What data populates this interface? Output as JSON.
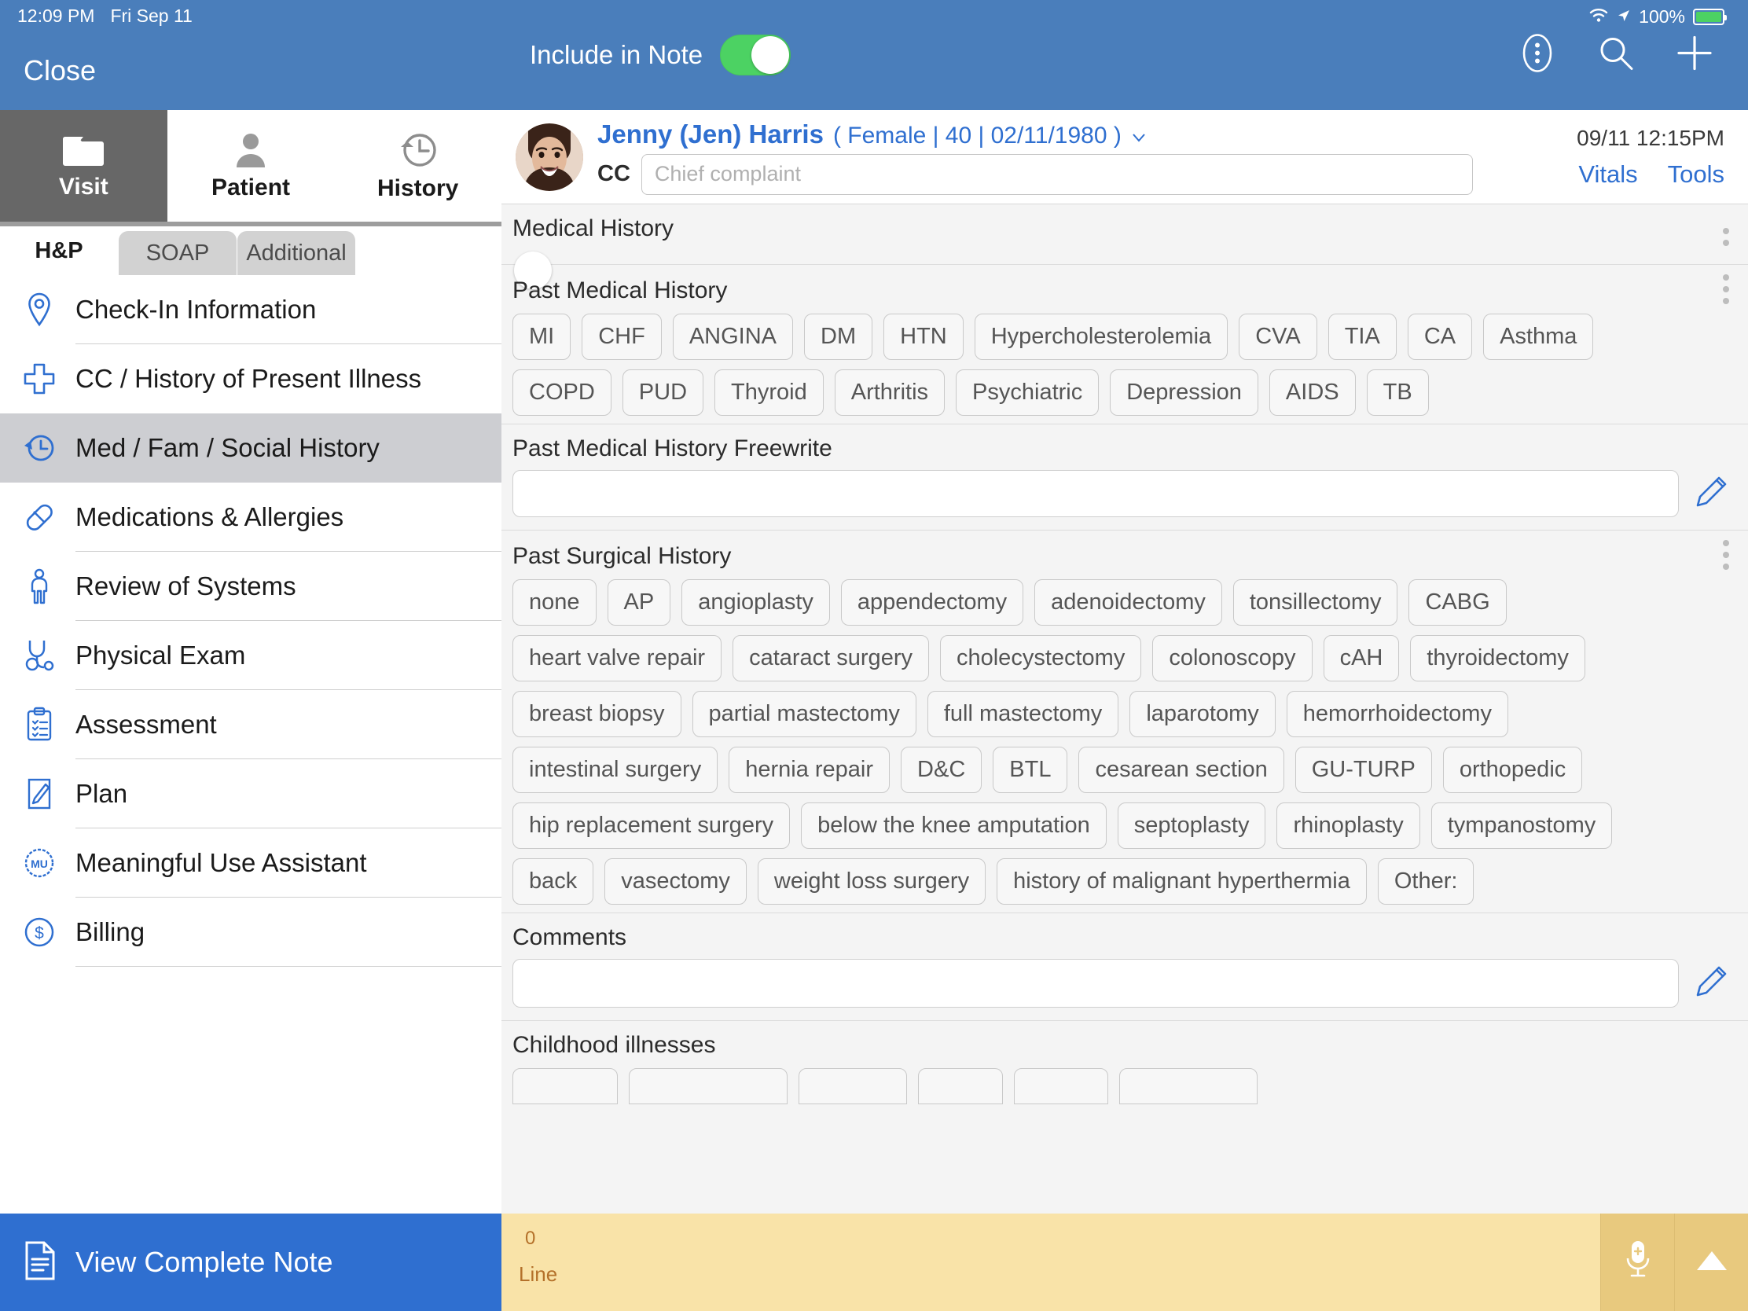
{
  "status_bar": {
    "time": "12:09 PM",
    "date": "Fri Sep 11",
    "battery_percent": "100%"
  },
  "left_panel": {
    "close_label": "Close",
    "mode_tabs": [
      {
        "label": "Visit",
        "icon": "folder-icon",
        "active": true
      },
      {
        "label": "Patient",
        "icon": "person-icon",
        "active": false
      },
      {
        "label": "History",
        "icon": "clock-history-icon",
        "active": false
      }
    ],
    "hp_tabs": [
      {
        "label": "H&P",
        "active": true
      },
      {
        "label": "SOAP",
        "active": false
      },
      {
        "label": "Additional",
        "active": false
      }
    ],
    "nav_items": [
      {
        "label": "Check-In Information",
        "icon": "map-pin-icon",
        "active": false
      },
      {
        "label": "CC / History of Present Illness",
        "icon": "plus-cross-icon",
        "active": false
      },
      {
        "label": "Med / Fam / Social History",
        "icon": "clock-history-icon",
        "active": true
      },
      {
        "label": "Medications & Allergies",
        "icon": "pill-icon",
        "active": false
      },
      {
        "label": "Review of Systems",
        "icon": "body-icon",
        "active": false
      },
      {
        "label": "Physical Exam",
        "icon": "stethoscope-icon",
        "active": false
      },
      {
        "label": "Assessment",
        "icon": "clipboard-checklist-icon",
        "active": false
      },
      {
        "label": "Plan",
        "icon": "pen-document-icon",
        "active": false
      },
      {
        "label": "Meaningful Use Assistant",
        "icon": "mu-badge-icon",
        "active": false
      },
      {
        "label": "Billing",
        "icon": "dollar-circle-icon",
        "active": false
      }
    ],
    "view_complete_note": "View Complete Note"
  },
  "top_bar": {
    "include_in_note_label": "Include in Note",
    "include_in_note_on": true,
    "icons": [
      "more-vertical-icon",
      "search-icon",
      "plus-icon"
    ]
  },
  "patient_header": {
    "name": "Jenny (Jen) Harris",
    "demographics": "( Female | 40 | 02/11/1980 )",
    "cc_label": "CC",
    "cc_value": "",
    "cc_placeholder": "Chief complaint",
    "timestamp": "09/11 12:15PM",
    "links": [
      "Vitals",
      "Tools"
    ]
  },
  "main": {
    "medical_history": {
      "title": "Medical History",
      "toggle_on": false
    },
    "past_medical_history": {
      "title": "Past Medical History",
      "chips": [
        "MI",
        "CHF",
        "ANGINA",
        "DM",
        "HTN",
        "Hypercholesterolemia",
        "CVA",
        "TIA",
        "CA",
        "Asthma",
        "COPD",
        "PUD",
        "Thyroid",
        "Arthritis",
        "Psychiatric",
        "Depression",
        "AIDS",
        "TB"
      ]
    },
    "pmh_freewrite": {
      "label": "Past Medical History Freewrite",
      "value": ""
    },
    "past_surgical_history": {
      "title": "Past Surgical History",
      "chips": [
        "none",
        "AP",
        "angioplasty",
        "appendectomy",
        "adenoidectomy",
        "tonsillectomy",
        "CABG",
        "heart valve repair",
        "cataract surgery",
        "cholecystectomy",
        "colonoscopy",
        "cAH",
        "thyroidectomy",
        "breast biopsy",
        "partial mastectomy",
        "full mastectomy",
        "laparotomy",
        "hemorrhoidectomy",
        "intestinal surgery",
        "hernia repair",
        "D&C",
        "BTL",
        "cesarean section",
        "GU-TURP",
        "orthopedic",
        "hip replacement surgery",
        "below the knee amputation",
        "septoplasty",
        "rhinoplasty",
        "tympanostomy",
        "back",
        "vasectomy",
        "weight loss surgery",
        "history of malignant hyperthermia",
        "Other:"
      ]
    },
    "comments": {
      "label": "Comments",
      "value": ""
    },
    "childhood_illnesses": {
      "title": "Childhood illnesses"
    }
  },
  "footer": {
    "line_count": "0",
    "line_label": "Line",
    "mic_icon": "microphone-add-icon",
    "expand_icon": "triangle-up-icon"
  },
  "colors": {
    "brand_blue": "#4a7ebb",
    "accent_blue": "#2f6fd0",
    "toggle_green": "#4cd263",
    "footer_yellow": "#f9e3a8"
  }
}
